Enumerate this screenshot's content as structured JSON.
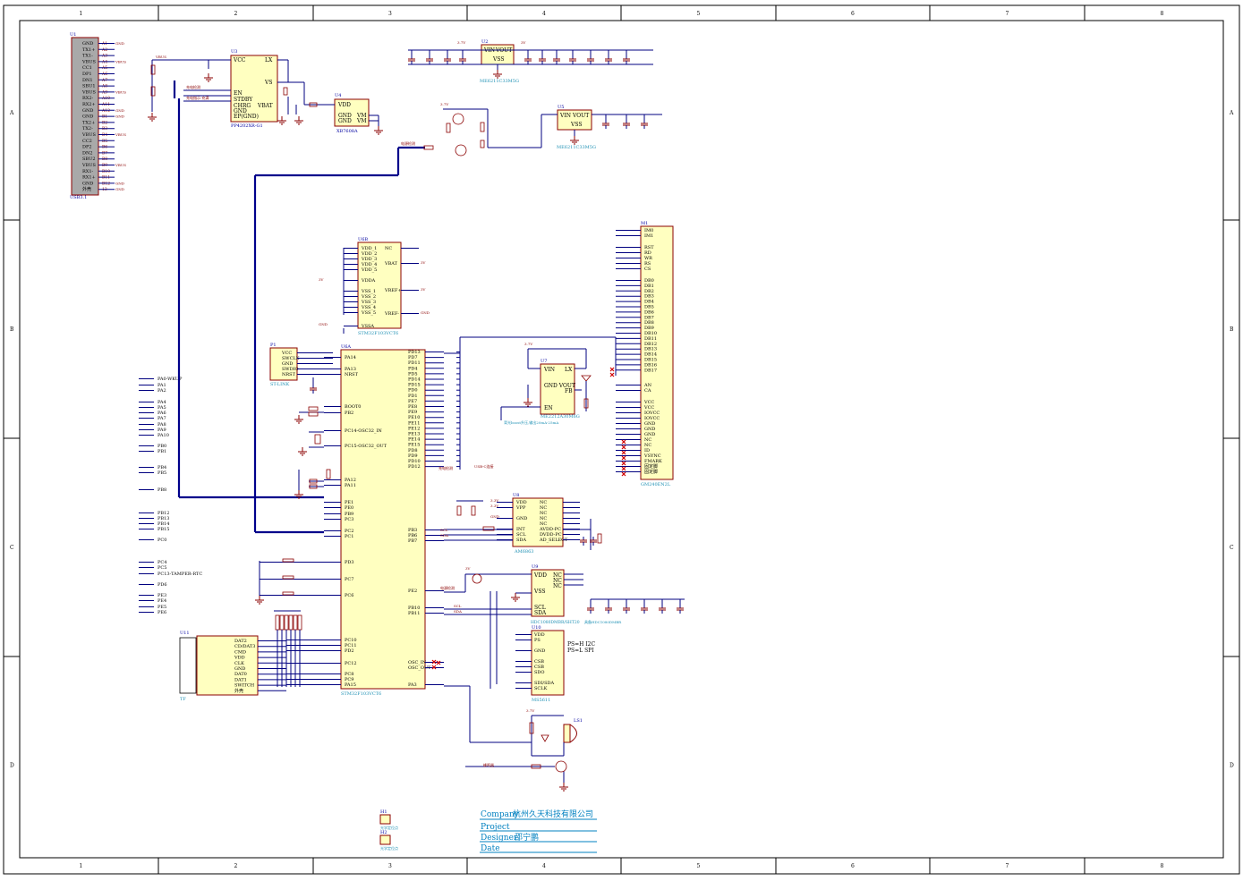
{
  "border": {
    "columns": [
      "1",
      "2",
      "3",
      "4",
      "5",
      "6",
      "7",
      "8"
    ],
    "rows": [
      "A",
      "B",
      "C",
      "D"
    ]
  },
  "title_block": {
    "company_label": "Company",
    "company_value": "杭州久天科技有限公司",
    "project_label": "Project",
    "designer_label": "Designer",
    "designer_value": "邵宁鹏",
    "date_label": "Date"
  },
  "parts": {
    "usb": {
      "ref": "U1",
      "name": "USB3.1",
      "pins_left": [
        "GND",
        "TX1+",
        "TX1-",
        "VBUS",
        "CC1",
        "DP1",
        "DN1",
        "SBU1",
        "VBUS",
        "RX2-",
        "RX2+",
        "GND",
        "GND",
        "TX2+",
        "TX2-",
        "VBUS",
        "CC2",
        "DP2",
        "DN2",
        "SBU2",
        "VBUS",
        "RX1-",
        "RX1+",
        "GND",
        "外壳"
      ],
      "pins_num": [
        "A1",
        "A2",
        "A3",
        "A4",
        "A5",
        "A6",
        "A7",
        "A8",
        "A9",
        "A10",
        "A11",
        "A12",
        "B1",
        "B2",
        "B3",
        "B4",
        "B5",
        "B6",
        "B7",
        "B8",
        "B9",
        "B10",
        "B11",
        "B12",
        "13"
      ]
    },
    "charger": {
      "ref": "U3",
      "name": "PP4202XR-G1",
      "pins": [
        "VCC",
        "LX",
        "VS",
        "EN",
        "STDBY",
        "CHRG",
        "GND",
        "EP(GND)",
        "VBAT"
      ]
    },
    "ldo_small": {
      "ref": "U4",
      "name": "XB7608A",
      "pins": [
        "VDD",
        "GND",
        "GND",
        "VM",
        "VM"
      ]
    },
    "ldo_top": {
      "ref": "U2",
      "name": "ME6211C33M5G",
      "pins": [
        "VIN",
        "VOUT",
        "VSS"
      ]
    },
    "ldo_right": {
      "ref": "U5",
      "name": "ME6211C33M5G",
      "pins": [
        "VIN",
        "VOUT",
        "VSS"
      ]
    },
    "power_block": {
      "ref": "U6B",
      "name": "STM32F103VCT6",
      "pins_left": [
        "VDD_1",
        "VDD_2",
        "VDD_3",
        "VDD_4",
        "VDD_5",
        "VDDA",
        "VSS_1",
        "VSS_2",
        "VSS_3",
        "VSS_4",
        "VSS_5",
        "VSSA"
      ],
      "pins_right": [
        "NC",
        "VBAT",
        "VREF+",
        "VREF-"
      ]
    },
    "mcu": {
      "ref": "U6A",
      "name": "STM32F103VCT6",
      "pins_left": [
        "PA14",
        "PA13",
        "NRST",
        "BOOT0",
        "PB2",
        "PC14-OSC32_IN",
        "PC15-OSC32_OUT",
        "PA12",
        "PA11",
        "PE1",
        "PE0",
        "PB9",
        "PC3",
        "PC2",
        "PC1",
        "PD3",
        "PC7",
        "PC6",
        "PC10",
        "PC11",
        "PD2",
        "PC12",
        "PC8",
        "PC9",
        "PA15"
      ],
      "pins_right": [
        "PD13",
        "PD7",
        "PD11",
        "PD4",
        "PD5",
        "PD14",
        "PD15",
        "PD0",
        "PD1",
        "PE7",
        "PE8",
        "PE9",
        "PE10",
        "PE11",
        "PE12",
        "PE13",
        "PE14",
        "PE15",
        "PD8",
        "PD9",
        "PD10",
        "PD12",
        "PB3",
        "PB6",
        "PB7",
        "PE2",
        "PB10",
        "PB11",
        "OSC_IN",
        "OSC_OUT",
        "PA3"
      ]
    },
    "stlink": {
      "ref": "P1",
      "name": "ST-LINK",
      "pins": [
        "VCC",
        "SWCLK",
        "GND",
        "SWDIO",
        "NRST"
      ]
    },
    "lcd": {
      "ref": "M1",
      "name": "GM240EN2L",
      "pins": [
        "IM0",
        "IM1",
        "RST",
        "RD",
        "WR",
        "RS",
        "CS",
        "DB0",
        "DB1",
        "DB2",
        "DB3",
        "DB4",
        "DB5",
        "DB6",
        "DB7",
        "DB8",
        "DB9",
        "DB10",
        "DB11",
        "DB12",
        "DB13",
        "DB14",
        "DB15",
        "DB16",
        "DB17",
        "AN",
        "CA",
        "VCC",
        "VCC",
        "IOVCC",
        "IOVCC",
        "GND",
        "GND",
        "GND",
        "NC",
        "NC",
        "ID",
        "VSYNC",
        "FMARK",
        "固定脚",
        "固定脚"
      ]
    },
    "boost": {
      "ref": "U7",
      "name": "ME2212A30M6G",
      "pins": [
        "VIN",
        "LX",
        "GND VOUT",
        "FB",
        "EN"
      ],
      "note": "背光boost升压,输出20mA-25mA"
    },
    "light_sensor": {
      "ref": "U8",
      "name": "AM6863",
      "pins_left": [
        "VDD",
        "VPP",
        "GND",
        "INT",
        "SCL",
        "SDA"
      ],
      "pins_right": [
        "NC",
        "NC",
        "NC",
        "NC",
        "NC",
        "AVDD-PC",
        "DVDD-PC",
        "AD_SELECT"
      ]
    },
    "humidity": {
      "ref": "U9",
      "name": "HDC1080DMBR/SHT20",
      "pins": [
        "VDD",
        "VSS",
        "SCL",
        "SDA",
        "NC",
        "NC",
        "NC"
      ],
      "note": "具备HDC1080DMBR"
    },
    "imu": {
      "ref": "U10",
      "name": "MS5611",
      "pins": [
        "VDD",
        "PS",
        "GND",
        "CSB",
        "CSB",
        "SDO",
        "SDI/SDA",
        "SCLK"
      ],
      "note": "PS=H  I2C\nPS=L  SPI"
    },
    "sdcard": {
      "ref": "U11",
      "name": "TF",
      "pins": [
        "DAT2",
        "CD/DAT3",
        "CMD",
        "VDD",
        "CLK",
        "GND",
        "DAT0",
        "DAT1",
        "SWITCH",
        "外壳"
      ]
    },
    "buzzer": {
      "ref": "LS1",
      "name": "BUZZER"
    },
    "mounting": [
      {
        "ref": "H1",
        "label": "光学定位点"
      },
      {
        "ref": "H2",
        "label": "光学定位点"
      }
    ]
  },
  "header_pins": [
    "PA0-WKUP",
    "PA1",
    "PA2",
    "PA4",
    "PA5",
    "PA6",
    "PA7",
    "PA8",
    "PA9",
    "PA10",
    "PB0",
    "PB1",
    "PB4",
    "PB5",
    "PB8",
    "PB12",
    "PB13",
    "PB14",
    "PB15",
    "PC0",
    "PC4",
    "PC5",
    "PC13-TAMPER-RTC",
    "PD6",
    "PE3",
    "PE4",
    "PE5",
    "PE6"
  ],
  "net_labels": {
    "vbus": "VBUS",
    "v37": "3.7V",
    "v3v": "3V",
    "v33": "3.3V",
    "gnd": "GND",
    "scl": "SCL",
    "sda": "SDA",
    "charge_status": "充电指示-充满",
    "charge_detect": "充电检测",
    "battery_detect": "电源检测",
    "buzzer_net": "蜂鸣器",
    "usb_c_cc": "USB-C连接"
  }
}
